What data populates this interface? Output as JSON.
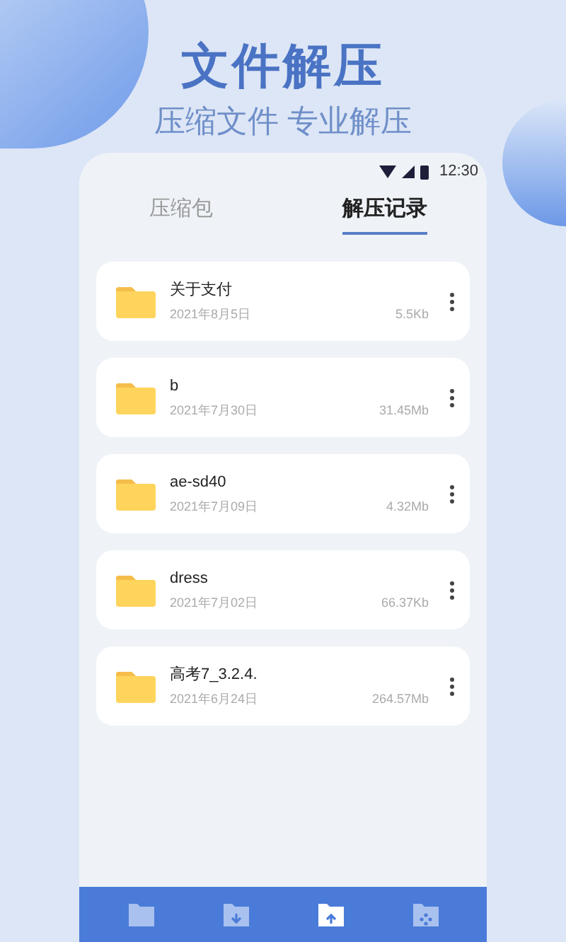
{
  "headline": "文件解压",
  "subheadline": "压缩文件 专业解压",
  "status_bar": {
    "time": "12:30"
  },
  "tabs": [
    {
      "label": "压缩包",
      "selected": false
    },
    {
      "label": "解压记录",
      "selected": true
    }
  ],
  "files": [
    {
      "name": "关于支付",
      "date": "2021年8月5日",
      "size": "5.5Kb"
    },
    {
      "name": "b",
      "date": "2021年7月30日",
      "size": "31.45Mb"
    },
    {
      "name": "ae-sd40",
      "date": "2021年7月09日",
      "size": "4.32Mb"
    },
    {
      "name": "dress",
      "date": "2021年7月02日",
      "size": "66.37Kb"
    },
    {
      "name": "高考7_3.2.4.",
      "date": "2021年6月24日",
      "size": "264.57Mb"
    }
  ],
  "bottom_nav": [
    {
      "kind": "folder",
      "selected": false
    },
    {
      "kind": "download",
      "selected": false
    },
    {
      "kind": "upload",
      "selected": true
    },
    {
      "kind": "apps",
      "selected": false
    }
  ]
}
